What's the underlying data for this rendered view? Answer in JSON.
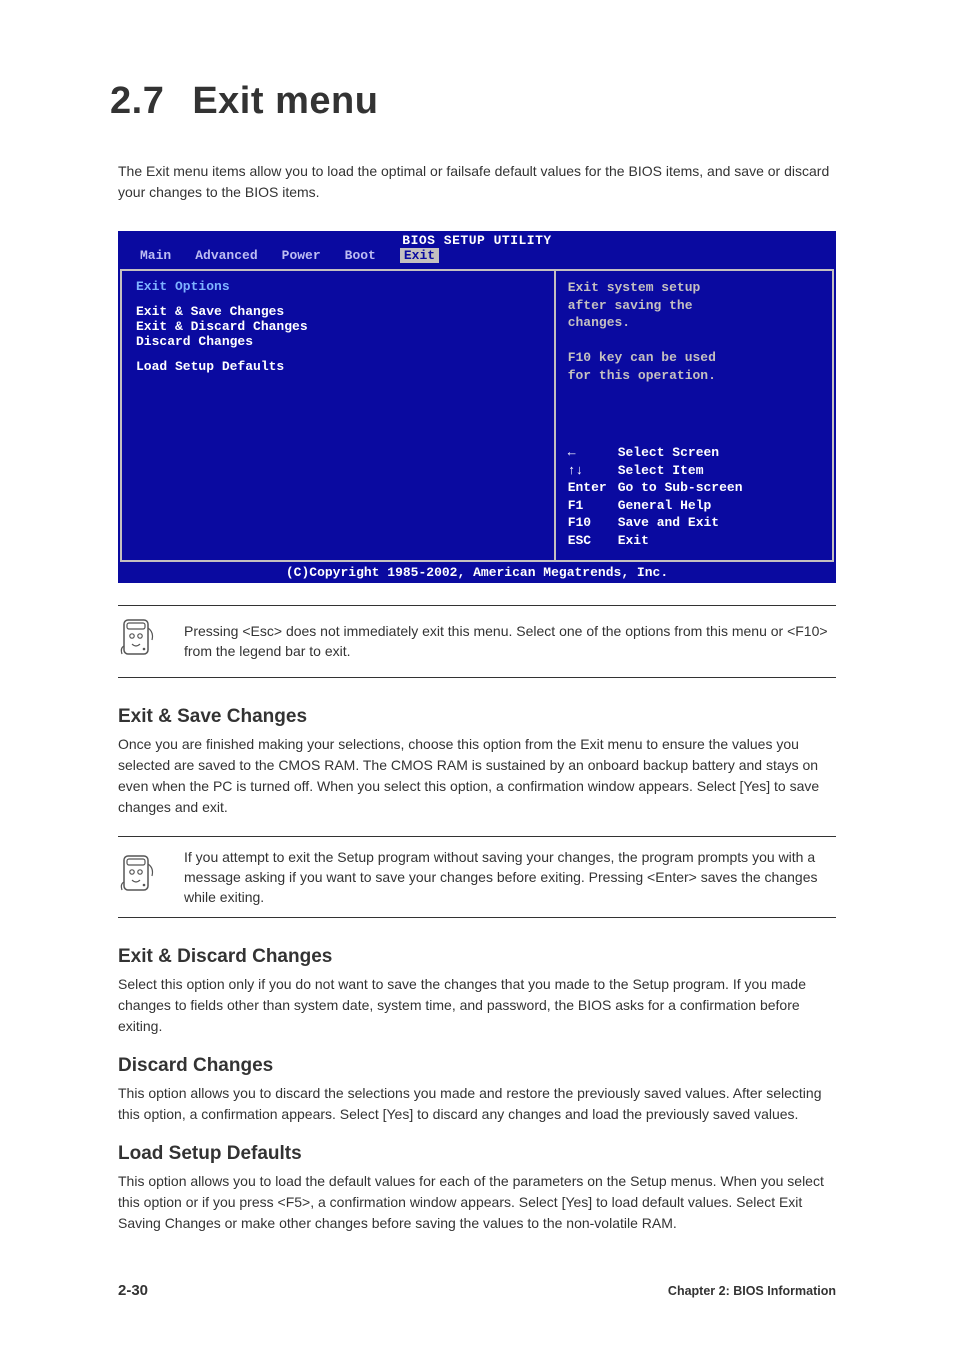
{
  "heading": {
    "num": "2.7",
    "title": "Exit menu"
  },
  "intro": "The Exit menu items allow you to load the optimal or failsafe default values for the BIOS items, and save or discard your changes to the BIOS items.",
  "bios": {
    "title": "BIOS SETUP UTILITY",
    "tabs": [
      "Main",
      "Advanced",
      "Power",
      "Boot",
      "Exit"
    ],
    "active_tab": "Exit",
    "left": {
      "section_title": "Exit Options",
      "options": [
        "Exit & Save Changes",
        "Exit & Discard Changes",
        "Discard Changes",
        "",
        "Load Setup Defaults"
      ]
    },
    "right": {
      "help_top_lines": [
        "Exit system setup",
        "after saving the",
        "changes.",
        "",
        "F10 key can be used",
        "for this operation."
      ],
      "nav": [
        {
          "key": "←",
          "label": "Select Screen"
        },
        {
          "key": "↑↓",
          "label": "Select Item"
        },
        {
          "key": "Enter",
          "label": "Go to Sub-screen"
        },
        {
          "key": "F1",
          "label": "General Help"
        },
        {
          "key": "F10",
          "label": "Save and Exit"
        },
        {
          "key": "ESC",
          "label": "Exit"
        }
      ]
    },
    "copyright": "(C)Copyright 1985-2002, American Megatrends, Inc."
  },
  "note1": "Pressing <Esc> does not immediately exit this menu. Select one of the options from this menu or <F10> from the legend bar to exit.",
  "sec_save": {
    "title": "Exit & Save Changes",
    "body": "Once you are finished making your selections, choose this option from the Exit menu to ensure the values you selected are saved to the CMOS RAM. The CMOS RAM is sustained by an onboard backup battery and stays on even when the PC is turned off. When you select this option, a confirmation window appears. Select [Yes] to save changes and exit."
  },
  "note2": "If you attempt to exit the Setup program without saving your changes, the program prompts you with a message asking if you want to save your changes before exiting. Pressing <Enter> saves the changes while exiting.",
  "sec_discard": {
    "title": "Exit & Discard Changes",
    "body": "Select this option only if you do not want to save the changes that you made to the Setup program. If you made changes to fields other than system date, system time, and password, the BIOS asks for a confirmation before exiting."
  },
  "sec_disc_changes": {
    "title": "Discard Changes",
    "body": "This option allows you to discard the selections you made and restore the previously saved values. After selecting this option, a confirmation appears. Select [Yes] to discard any changes and load the previously saved values."
  },
  "sec_load": {
    "title": "Load Setup Defaults",
    "body": "This option allows you to load the default values for each of the parameters on the Setup menus. When you select this option or if you press <F5>, a confirmation window appears. Select [Yes] to load default values. Select Exit Saving Changes or make other changes before saving the values to the non-volatile RAM."
  },
  "footer": {
    "page_num": "2-30",
    "chapter": "Chapter 2: BIOS Information"
  }
}
